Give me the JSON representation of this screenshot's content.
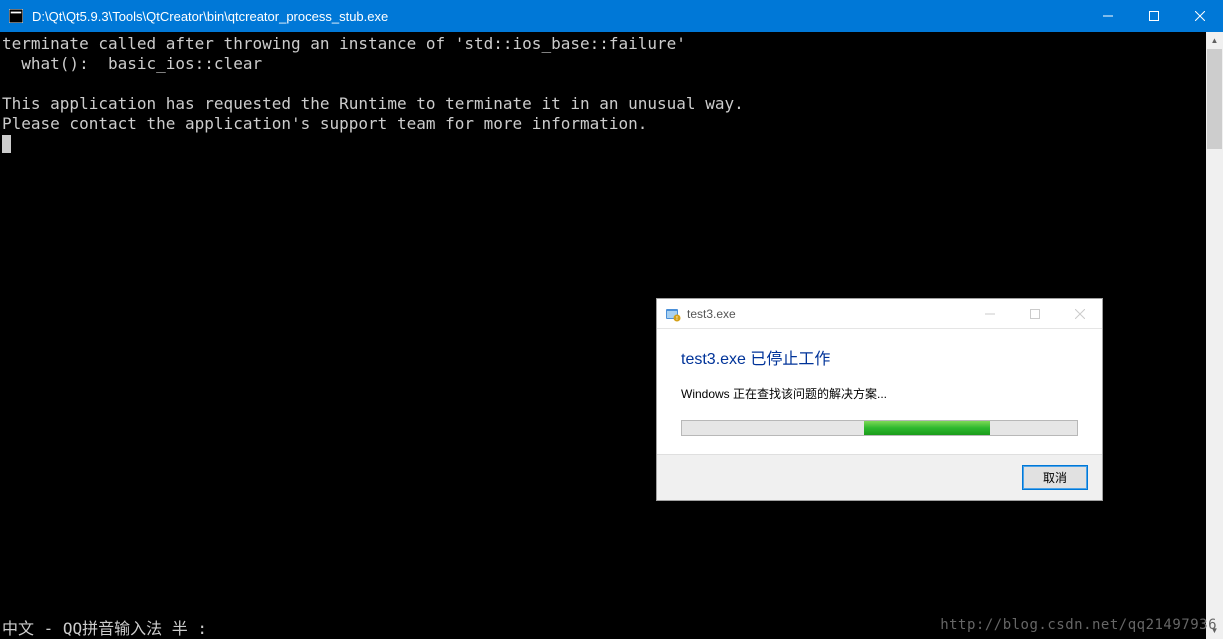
{
  "console": {
    "title": "D:\\Qt\\Qt5.9.3\\Tools\\QtCreator\\bin\\qtcreator_process_stub.exe",
    "lines": [
      "terminate called after throwing an instance of 'std::ios_base::failure'",
      "  what():  basic_ios::clear",
      "",
      "This application has requested the Runtime to terminate it in an unusual way.",
      "Please contact the application's support team for more information."
    ],
    "ime_status": "中文 - QQ拼音输入法 半 :"
  },
  "dialog": {
    "title": "test3.exe",
    "heading": "test3.exe 已停止工作",
    "message": "Windows 正在查找该问题的解决方案...",
    "cancel_label": "取消"
  },
  "watermark": "http://blog.csdn.net/qq21497936"
}
